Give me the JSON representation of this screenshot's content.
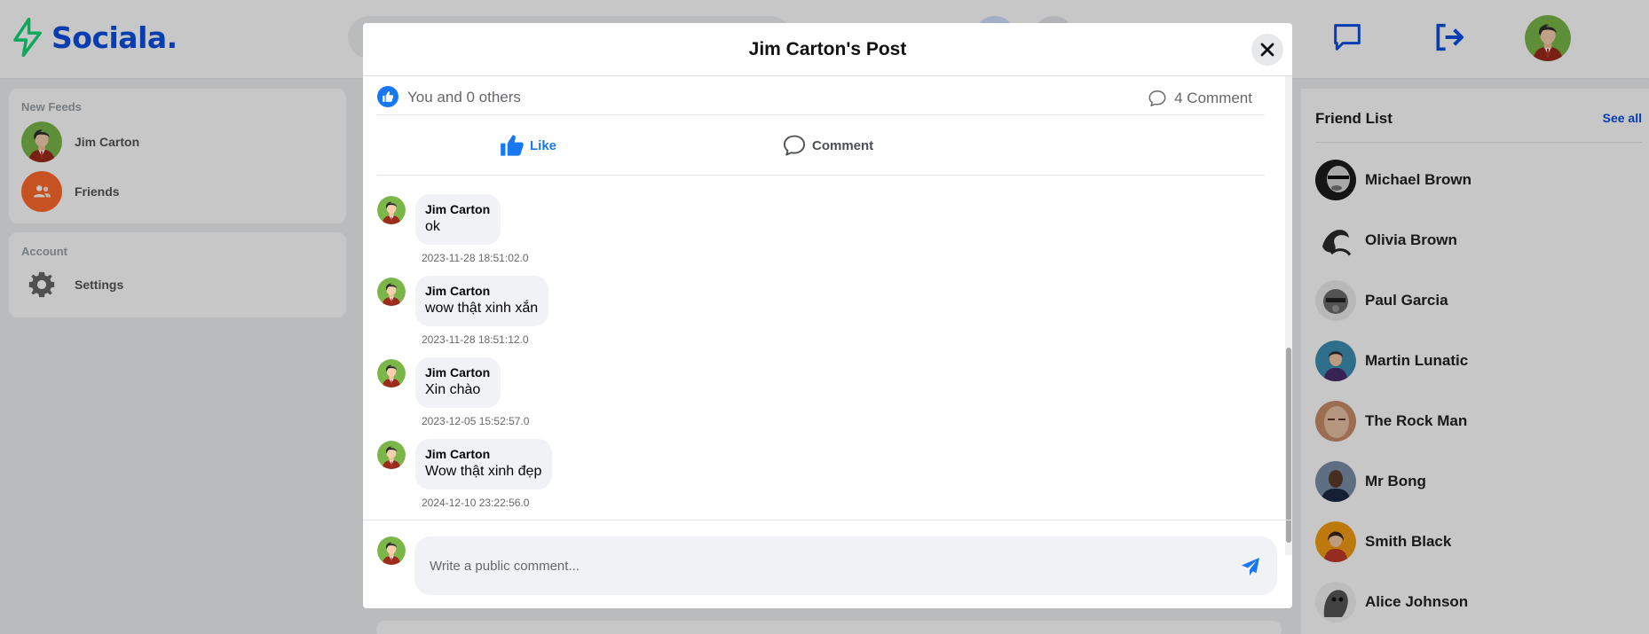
{
  "app": {
    "logo_text": "Sociala."
  },
  "sidebar": {
    "feeds_title": "New Feeds",
    "feeds_items": [
      {
        "label": "Jim Carton",
        "icon": "avatar"
      },
      {
        "label": "Friends",
        "icon": "users-icon"
      }
    ],
    "account_title": "Account",
    "account_items": [
      {
        "label": "Settings",
        "icon": "gear-icon"
      }
    ]
  },
  "friend_list": {
    "title": "Friend List",
    "see_all": "See all",
    "friends": [
      {
        "name": "Michael Brown"
      },
      {
        "name": "Olivia Brown"
      },
      {
        "name": "Paul Garcia"
      },
      {
        "name": "Martin Lunatic"
      },
      {
        "name": "The Rock Man"
      },
      {
        "name": "Mr Bong"
      },
      {
        "name": "Smith Black"
      },
      {
        "name": "Alice Johnson"
      }
    ]
  },
  "modal": {
    "title": "Jim Carton's Post",
    "likes_text": "You and 0 others",
    "comments_count": "4 Comment",
    "like_label": "Like",
    "comment_label": "Comment",
    "comments": [
      {
        "author": "Jim Carton",
        "text": "ok",
        "time": "2023-11-28 18:51:02.0"
      },
      {
        "author": "Jim Carton",
        "text": "wow thật xinh xắn",
        "time": "2023-11-28 18:51:12.0"
      },
      {
        "author": "Jim Carton",
        "text": "Xin chào",
        "time": "2023-12-05 15:52:57.0"
      },
      {
        "author": "Jim Carton",
        "text": "Wow thật xinh đẹp",
        "time": "2024-12-10 23:22:56.0"
      }
    ],
    "composer_placeholder": "Write a public comment..."
  },
  "colors": {
    "brand": "#0b4fe0",
    "like_blue": "#1877f2",
    "accent_green": "#10d876",
    "friends_orange": "#ff6a2b"
  }
}
